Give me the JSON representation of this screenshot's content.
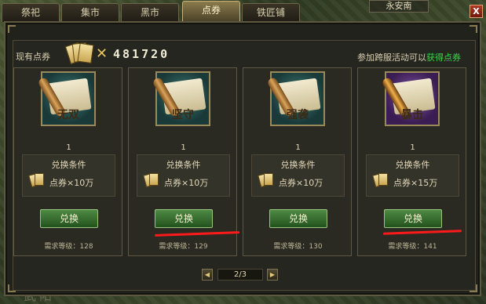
{
  "tabs": [
    {
      "label": "祭祀"
    },
    {
      "label": "集市"
    },
    {
      "label": "黑市"
    },
    {
      "label": "点券"
    },
    {
      "label": "铁匠铺"
    }
  ],
  "active_tab": "点券",
  "close_label": "X",
  "background": {
    "place_top": "永安南",
    "place_bottom": "武阳"
  },
  "header": {
    "current_label": "现有点券",
    "times_symbol": "✕",
    "amount": "481720",
    "cross_note_prefix": "参加跨服活动可以",
    "cross_note_link": "获得点券"
  },
  "cards": [
    {
      "name": "无双",
      "count": "1",
      "cond_title": "兑换条件",
      "cost": "点券×10万",
      "button": "兑换",
      "level": "需求等级：128",
      "icon": "scroll-icon",
      "frame": "teal"
    },
    {
      "name": "坚守",
      "count": "1",
      "cond_title": "兑换条件",
      "cost": "点券×10万",
      "button": "兑换",
      "level": "需求等级：129",
      "icon": "scroll-icon",
      "frame": "teal"
    },
    {
      "name": "强袭",
      "count": "1",
      "cond_title": "兑换条件",
      "cost": "点券×10万",
      "button": "兑换",
      "level": "需求等级：130",
      "icon": "scroll-icon",
      "frame": "teal"
    },
    {
      "name": "暴击",
      "count": "1",
      "cond_title": "兑换条件",
      "cost": "点券×15万",
      "button": "兑换",
      "level": "需求等级：141",
      "icon": "scroll-icon",
      "frame": "purple"
    }
  ],
  "pager": {
    "prev_icon": "◀",
    "next_icon": "▶",
    "text": "2/3"
  },
  "colors": {
    "highlight_link": "#39d64a",
    "annotation_red": "#ff1a1a",
    "button_green": "#4e8a44"
  }
}
